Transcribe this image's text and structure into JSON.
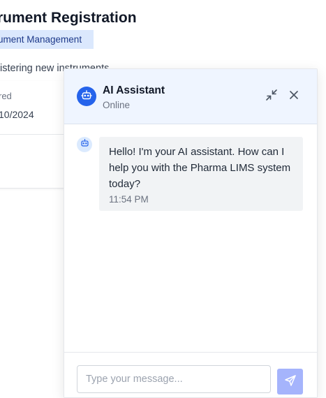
{
  "page": {
    "title": "rument Registration",
    "badge": "ument Management",
    "description": "istering new instruments",
    "field_label": "red",
    "field_value": "10/2024"
  },
  "chat": {
    "header": {
      "title": "AI Assistant",
      "status": "Online",
      "minimize_icon": "minimize-icon",
      "close_icon": "close-icon"
    },
    "messages": [
      {
        "sender": "assistant",
        "text": "Hello! I'm your AI assistant. How can I help you with the Pharma LIMS system today?",
        "time": "11:54 PM"
      }
    ],
    "input": {
      "value": "",
      "placeholder": "Type your message..."
    },
    "send_icon": "send-icon"
  },
  "colors": {
    "accent": "#2563eb",
    "header_bg": "#eff5ff",
    "bubble_bg": "#f1f3f5",
    "send_bg": "#a5b4fc",
    "badge_bg": "#dbe8fd"
  }
}
